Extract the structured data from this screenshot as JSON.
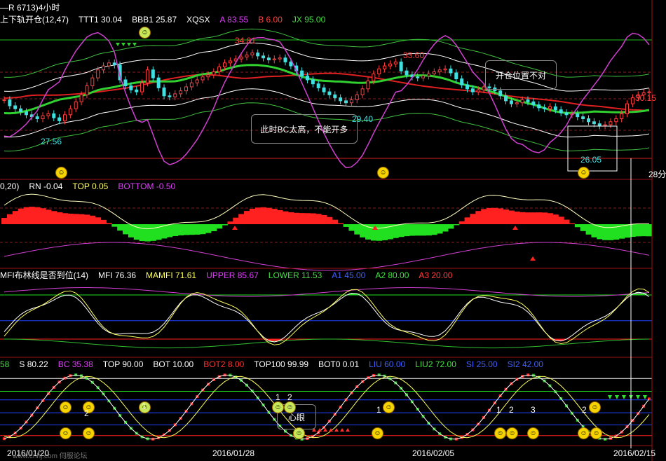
{
  "panel1": {
    "title": "—R 6713)4小时",
    "items": [
      {
        "text": "上下轨开仓(12,47)",
        "color": "#ffffff"
      },
      {
        "text": "TTT1 30.04",
        "color": "#ffffff"
      },
      {
        "text": "BBB1 25.87",
        "color": "#ffffff"
      },
      {
        "text": "XQSX",
        "color": "#ffffff"
      },
      {
        "text": "A 83.55",
        "color": "#e040fb"
      },
      {
        "text": "B 6.00",
        "color": "#ff4040"
      },
      {
        "text": "JX 95.00",
        "color": "#40e040"
      }
    ],
    "price_labels": [
      "34.81",
      "33.60",
      "29.40",
      "30.15",
      "27.56",
      "26.05",
      "28分"
    ],
    "notes": [
      "此时BC太高，不能开多",
      "开仓位置不对"
    ]
  },
  "panel2": {
    "items": [
      {
        "text": "0,20)",
        "color": "#ffffff"
      },
      {
        "text": "RN -0.04",
        "color": "#ffffff"
      },
      {
        "text": "TOP 0.05",
        "color": "#ffff60"
      },
      {
        "text": "BOTTOM -0.50",
        "color": "#e040fb"
      }
    ]
  },
  "panel3": {
    "items": [
      {
        "text": "MFI布林线是否到位(14)",
        "color": "#ffffff"
      },
      {
        "text": "MFI 76.36",
        "color": "#ffffff"
      },
      {
        "text": "MAMFI 71.61",
        "color": "#ffff60"
      },
      {
        "text": "UPPER 85.67",
        "color": "#e040fb"
      },
      {
        "text": "LOWER 11.53",
        "color": "#40e040"
      },
      {
        "text": "A1 45.00",
        "color": "#4060ff"
      },
      {
        "text": "A2 80.00",
        "color": "#40e040"
      },
      {
        "text": "A3 20.00",
        "color": "#ff4040"
      }
    ]
  },
  "panel4": {
    "items": [
      {
        "text": "58",
        "color": "#40e040"
      },
      {
        "text": "S 80.22",
        "color": "#ffffff"
      },
      {
        "text": "BC 35.38",
        "color": "#e040fb"
      },
      {
        "text": "TOP 90.00",
        "color": "#ffffff"
      },
      {
        "text": "BOT 10.00",
        "color": "#ffffff"
      },
      {
        "text": "BOT2 8.00",
        "color": "#ff3030"
      },
      {
        "text": "TOP100 99.99",
        "color": "#ffffff"
      },
      {
        "text": "BOT0 0.01",
        "color": "#ffffff"
      },
      {
        "text": "LIU 60.00",
        "color": "#4060ff"
      },
      {
        "text": "LIU2 72.00",
        "color": "#40e040"
      },
      {
        "text": "SI 25.00",
        "color": "#4060ff"
      },
      {
        "text": "SI2 42.00",
        "color": "#4060ff"
      }
    ],
    "note": "心眼",
    "markers": [
      "1",
      "2",
      "1",
      "2",
      "1",
      "1",
      "2",
      "3",
      "2"
    ]
  },
  "axis": {
    "dates": [
      "2016/01/20",
      "2016/01/28",
      "2016/02/05",
      "2016/02/15"
    ],
    "watermark": "www.cnhj.com 伺服论坛"
  },
  "chart_data": {
    "type": "candlestick",
    "title": "上下轨开仓(12,47)",
    "x": [
      "2016/01/20",
      "2016/01/28",
      "2016/02/05",
      "2016/02/15"
    ],
    "annotated_prices": [
      {
        "label": "34.81",
        "value": 34.81
      },
      {
        "label": "33.60",
        "value": 33.6
      },
      {
        "label": "29.40",
        "value": 29.4
      },
      {
        "label": "30.15",
        "value": 30.15
      },
      {
        "label": "27.56",
        "value": 27.56
      },
      {
        "label": "26.05",
        "value": 26.05
      }
    ],
    "close": [
      29.8,
      29.2,
      28.9,
      28.6,
      28.3,
      28.1,
      27.9,
      28.2,
      28.4,
      28.0,
      27.7,
      28.3,
      28.9,
      29.6,
      30.3,
      31.2,
      32.0,
      32.8,
      33.2,
      33.5,
      33.3,
      31.8,
      31.2,
      30.8,
      30.6,
      31.5,
      32.8,
      32.0,
      31.0,
      30.2,
      30.1,
      30.4,
      30.7,
      31.1,
      31.5,
      31.8,
      32.1,
      32.3,
      32.6,
      33.1,
      33.5,
      33.7,
      33.9,
      34.1,
      34.3,
      34.5,
      34.2,
      34.0,
      33.8,
      33.9,
      34.0,
      33.6,
      33.2,
      32.7,
      32.2,
      31.8,
      31.4,
      31.0,
      30.6,
      30.3,
      30.0,
      29.7,
      29.5,
      29.8,
      30.3,
      30.9,
      31.7,
      32.4,
      32.9,
      33.2,
      33.4,
      33.6,
      32.7,
      32.3,
      32.1,
      32.0,
      32.2,
      32.4,
      32.6,
      32.8,
      32.9,
      32.5,
      31.9,
      31.3,
      30.9,
      30.6,
      30.8,
      31.1,
      31.0,
      30.7,
      30.2,
      29.7,
      29.4,
      29.5,
      29.8,
      29.6,
      29.3,
      29.0,
      28.9,
      29.1,
      28.8,
      28.5,
      28.3,
      28.4,
      28.1,
      27.9,
      27.6,
      27.4,
      27.2,
      27.3,
      27.6,
      27.9,
      28.4,
      29.4,
      30.0,
      30.3,
      30.5,
      30.6
    ],
    "xqsx": {
      "A": 83.55,
      "B": 6.0,
      "JX": 95.0,
      "TTT1": 30.04,
      "BBB1": 25.87
    },
    "rn": {
      "RN": -0.04,
      "TOP": 0.05,
      "BOTTOM": -0.5
    },
    "mfi": {
      "MFI": 76.36,
      "MAMFI": 71.61,
      "UPPER": 85.67,
      "LOWER": 11.53,
      "A1": 45.0,
      "A2": 80.0,
      "A3": 20.0
    },
    "kd": {
      "S": 80.22,
      "BC": 35.38,
      "TOP": 90.0,
      "BOT": 10.0,
      "BOT2": 8.0,
      "TOP100": 99.99,
      "BOT0": 0.01,
      "LIU": 60.0,
      "LIU2": 72.0,
      "SI": 25.0,
      "SI2": 42.0
    }
  }
}
